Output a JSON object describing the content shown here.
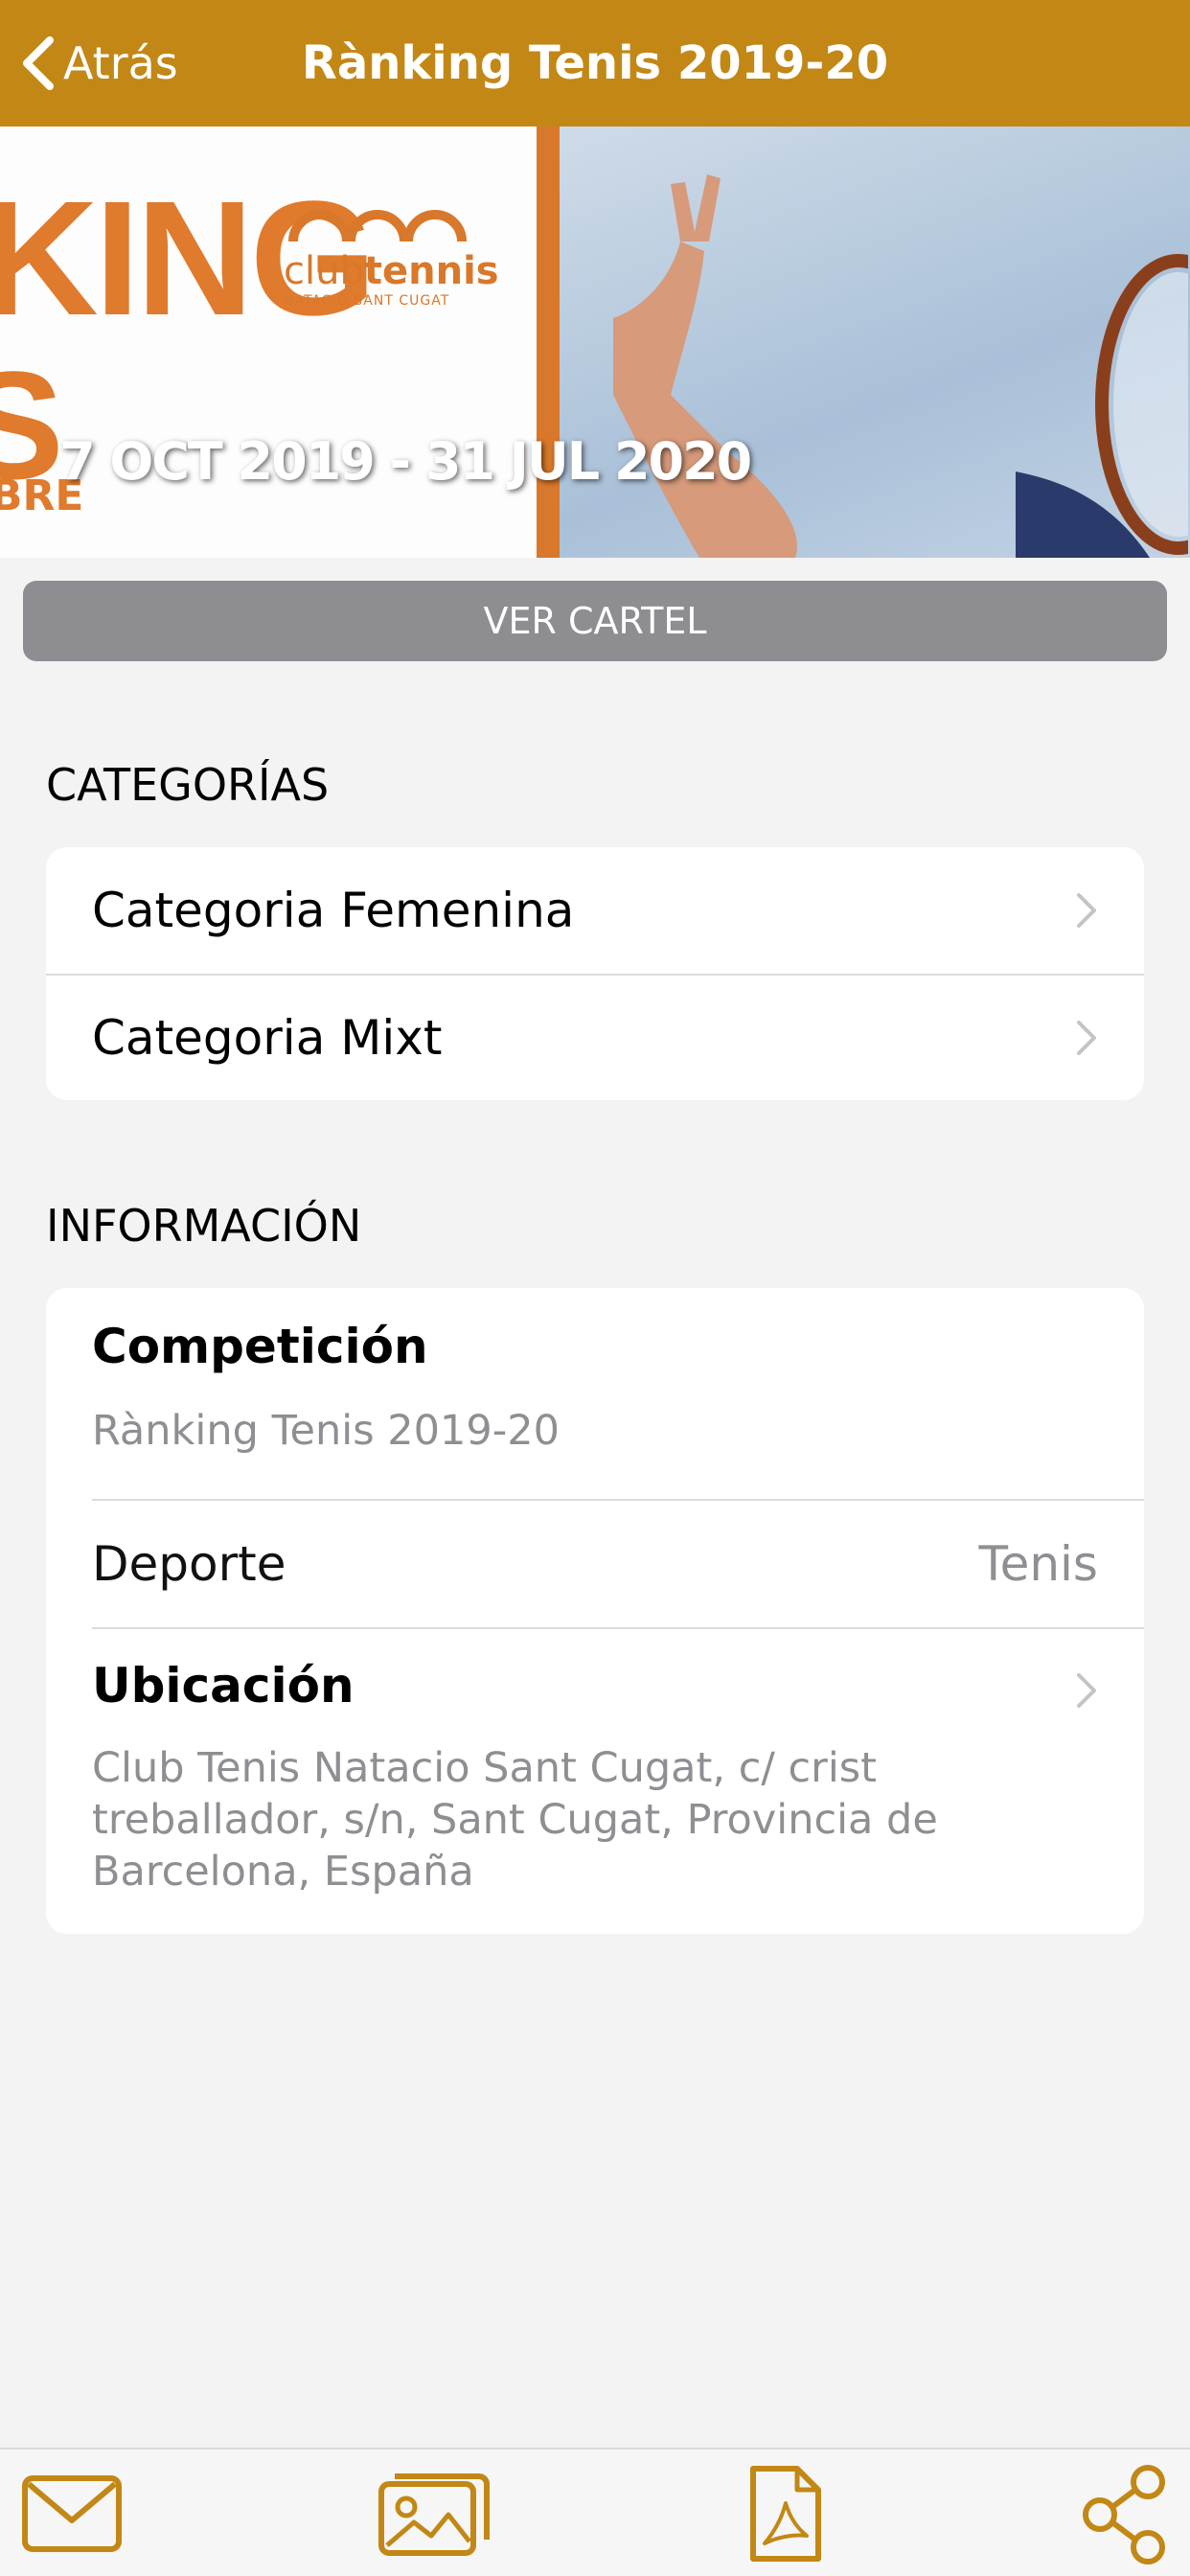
{
  "header": {
    "back_label": "Atrás",
    "title": "Rànking Tenis 2019-20"
  },
  "banner": {
    "big_text_1": "KING",
    "big_text_2": "S",
    "small_text": "BRE",
    "logo_text_light": "club",
    "logo_text_bold": "tennis",
    "logo_subtext": "NATACIÓ SANT CUGAT",
    "dates": "7 OCT 2019 - 31 JUL 2020"
  },
  "ver_cartel_label": "VER CARTEL",
  "categorias": {
    "title": "CATEGORÍAS",
    "items": [
      {
        "label": "Categoria Femenina"
      },
      {
        "label": "Categoria Mixt"
      }
    ]
  },
  "informacion": {
    "title": "INFORMACIÓN",
    "competicion_label": "Competición",
    "competicion_value": "Rànking Tenis 2019-20",
    "deporte_label": "Deporte",
    "deporte_value": "Tenis",
    "ubicacion_label": "Ubicación",
    "ubicacion_value": "Club Tenis Natacio Sant Cugat, c/ crist treballador, s/n, Sant Cugat, Provincia de Barcelona, España"
  },
  "tabbar": {
    "icons": [
      "mail-icon",
      "image-gallery-icon",
      "pdf-document-icon",
      "share-icon"
    ]
  },
  "colors": {
    "accent": "#c28715",
    "button_gray": "#8d8d92",
    "secondary_text": "#8e8e93",
    "banner_orange": "#e07a2c"
  }
}
